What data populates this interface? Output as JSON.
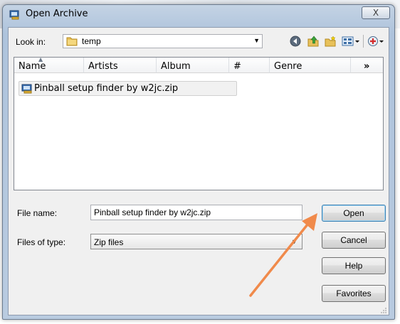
{
  "window": {
    "title": "Open Archive",
    "close_glyph": "X"
  },
  "toolbar": {
    "look_in_label": "Look in:",
    "look_in_value": "temp",
    "icons": [
      "back-icon",
      "up-folder-icon",
      "new-folder-icon",
      "view-menu-icon",
      "add-icon"
    ]
  },
  "list": {
    "columns": [
      "Name",
      "Artists",
      "Album",
      "#",
      "Genre",
      "»"
    ],
    "items": [
      {
        "name": "Pinball setup finder by w2jc.zip"
      }
    ]
  },
  "form": {
    "file_name_label": "File name:",
    "file_name_value": "Pinball setup finder by w2jc.zip",
    "file_type_label": "Files of type:",
    "file_type_value": "Zip files"
  },
  "buttons": {
    "open": "Open",
    "cancel": "Cancel",
    "help": "Help",
    "favorites": "Favorites"
  },
  "colors": {
    "annotation_arrow": "#f08a4b",
    "window_frame": "#b9cbe0"
  }
}
